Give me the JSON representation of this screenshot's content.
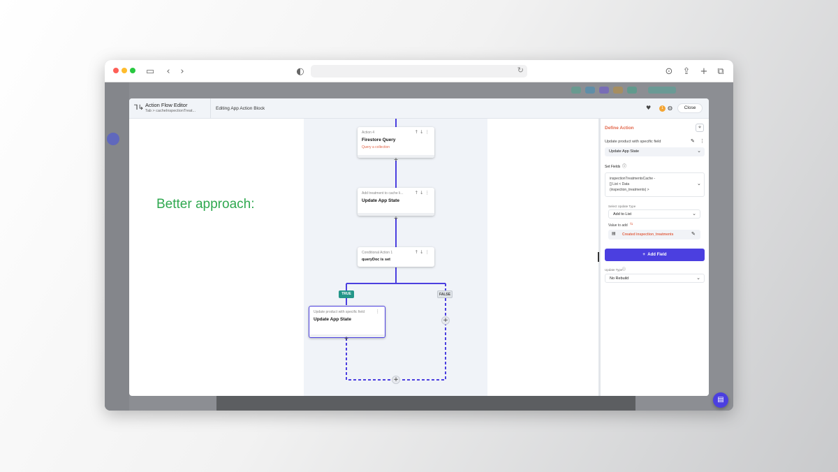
{
  "browser": {
    "icons": [
      "sidebar-icon",
      "back-icon",
      "forward-icon",
      "shield-icon",
      "reload-icon",
      "download-icon",
      "share-icon",
      "new-tab-icon",
      "tabs-icon"
    ]
  },
  "editor": {
    "title": "Action Flow Editor",
    "breadcrumb": "Tab  >  cacheInspectionTreat...",
    "subtitle": "Editing App Action Block",
    "badge_count": "1",
    "close_label": "Close"
  },
  "caption": "Better approach:",
  "flow": {
    "nodes": [
      {
        "label": "Action 4",
        "title": "Firestore Query",
        "subtitle": "Query a collection"
      },
      {
        "label": "Add treatment to cache li...",
        "title": "Update App State"
      },
      {
        "label": "Conditional Action 1",
        "title": "queryDoc is set"
      },
      {
        "label": "Update product with specific field",
        "title": "Update App State"
      }
    ],
    "true_label": "TRUE",
    "false_label": "FALSE"
  },
  "panel": {
    "title": "Define Action",
    "action_name": "Update product with specific field",
    "action_type": "Update App State",
    "set_fields_label": "Set Fields",
    "field_lines": [
      "inspectionTreatmentsCache -",
      "[] List < Data",
      "(inspection_treatments) >"
    ],
    "update_type_label": "Select Update Type",
    "update_type_value": "Add to List",
    "value_label": "Value to add",
    "value_text": "Created inspection_treatments",
    "add_field_label": "Add Field",
    "rebuild_label": "Update Type",
    "rebuild_value": "No Rebuild"
  },
  "colors": {
    "accent": "#4b3fe0",
    "caption": "#2fa84f",
    "true_tag": "#249689",
    "warning": "#e2664a"
  }
}
